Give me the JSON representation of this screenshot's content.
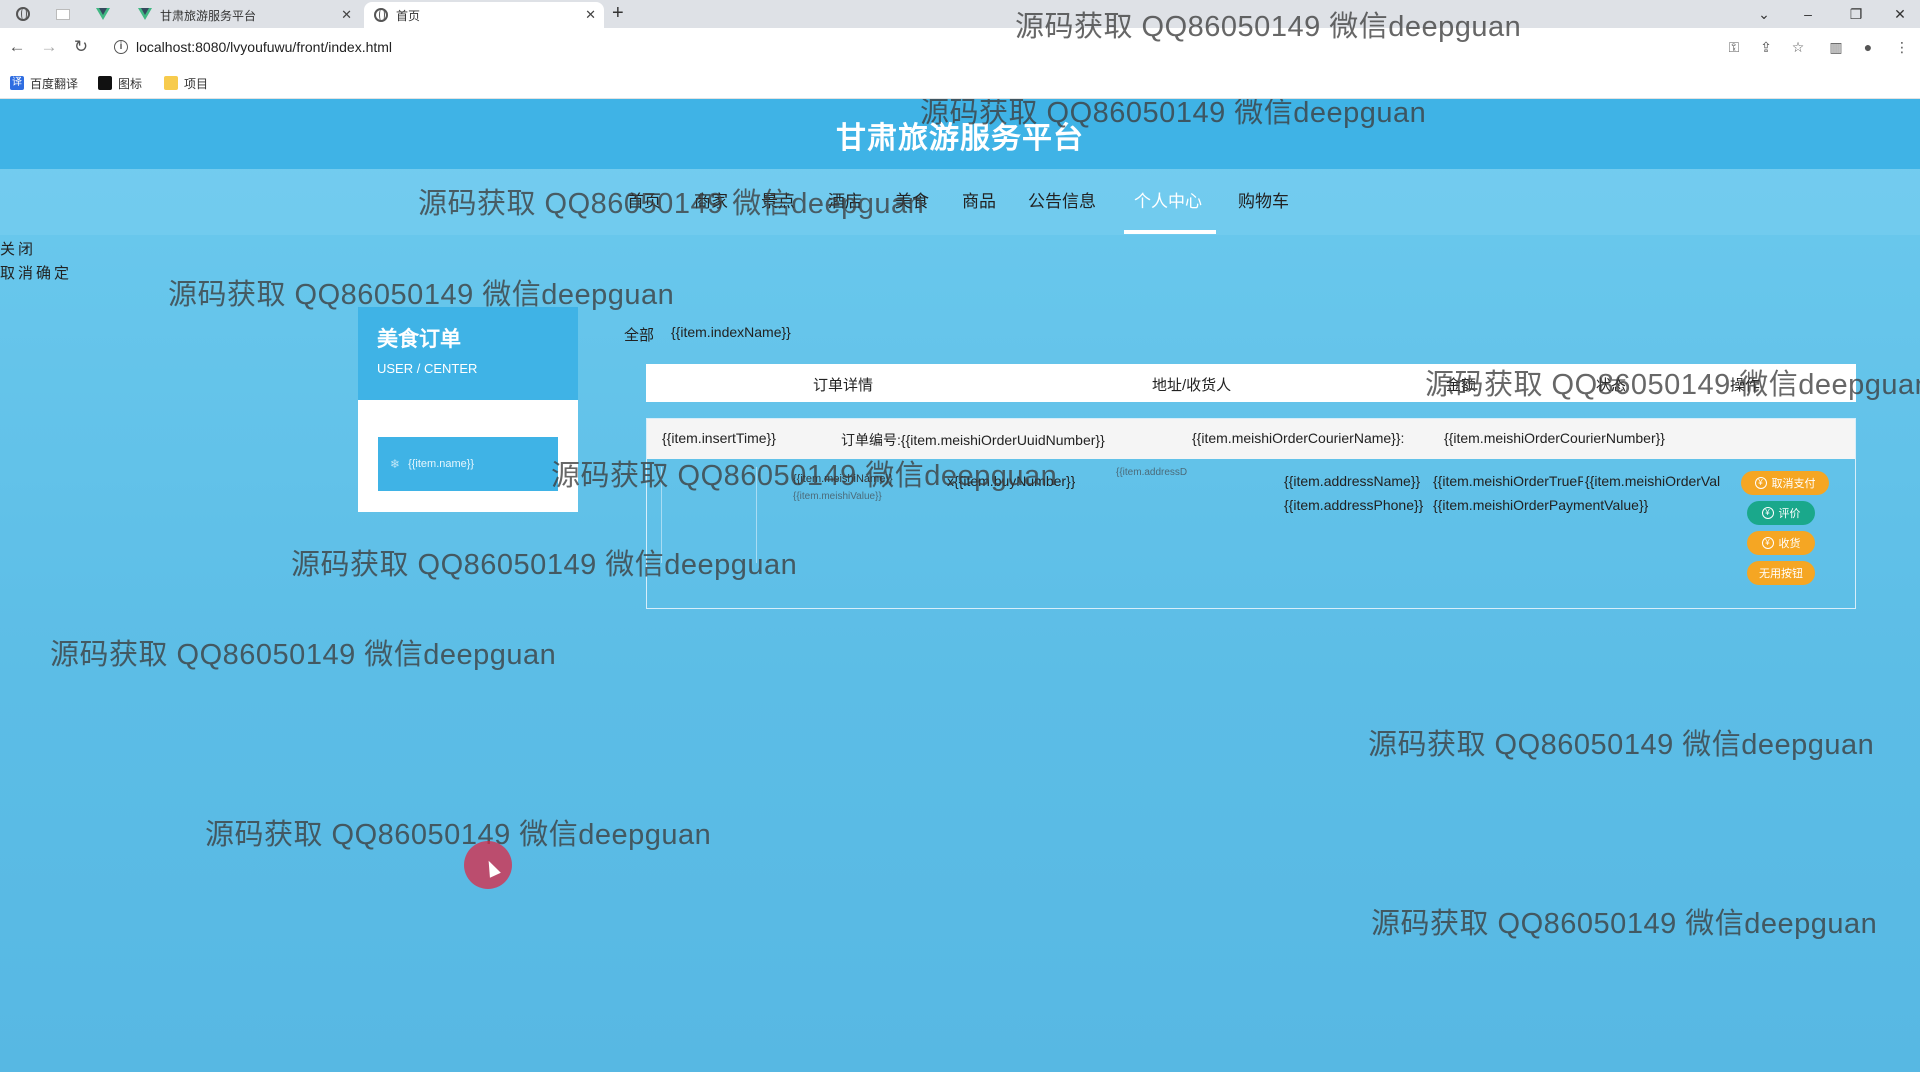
{
  "browser": {
    "tabs": [
      {
        "title": "甘肃旅游服务平台",
        "active": false
      },
      {
        "title": "首页",
        "active": true
      }
    ],
    "new_tab": "+",
    "url": "localhost:8080/lvyoufuwu/front/index.html",
    "bookmarks": [
      "百度翻译",
      "图标",
      "项目"
    ]
  },
  "site": {
    "title": "甘肃旅游服务平台",
    "nav": [
      "首页",
      "商家",
      "景点",
      "酒店",
      "美食",
      "商品",
      "公告信息",
      "个人中心",
      "购物车"
    ],
    "active_nav": "个人中心"
  },
  "dialog": {
    "close": "关闭",
    "cancel_confirm": "取消确定"
  },
  "sidebar": {
    "title": "美食订单",
    "subtitle": "USER / CENTER",
    "item": "{{item.name}}"
  },
  "filters": [
    "全部",
    "{{item.indexName}}"
  ],
  "table": {
    "headers": [
      "订单详情",
      "地址/收货人",
      "金额",
      "状态",
      "操作"
    ]
  },
  "order": {
    "insert_time": "{{item.insertTime}}",
    "order_number": "订单编号:{{item.meishiOrderUuidNumber}}",
    "courier": "{{item.meishiOrderCourierName}}:",
    "courier_number": "{{item.meishiOrderCourierNumber}}",
    "meishi_name": "{{item.meishiName}}",
    "meishi_value": "{{item.meishiValue}}",
    "buy_number": "x{{item.buyNumber}}",
    "address_short": "{{item.addressD",
    "address_name": "{{item.addressName}}",
    "address_phone": "{{item.addressPhone}}",
    "true_price": "{{item.meishiOrderTruePrice}}",
    "payment_value": "{{item.meishiOrderPaymentValue}}",
    "order_value": "{{item.meishiOrderVal",
    "buttons": [
      "取消支付",
      "评价",
      "收货",
      "无用按钮"
    ],
    "button_colors": [
      "#f5a623",
      "#1aa88b",
      "#f5a623",
      "#f5a623"
    ]
  },
  "watermark": "源码获取 QQ86050149 微信deepguan"
}
